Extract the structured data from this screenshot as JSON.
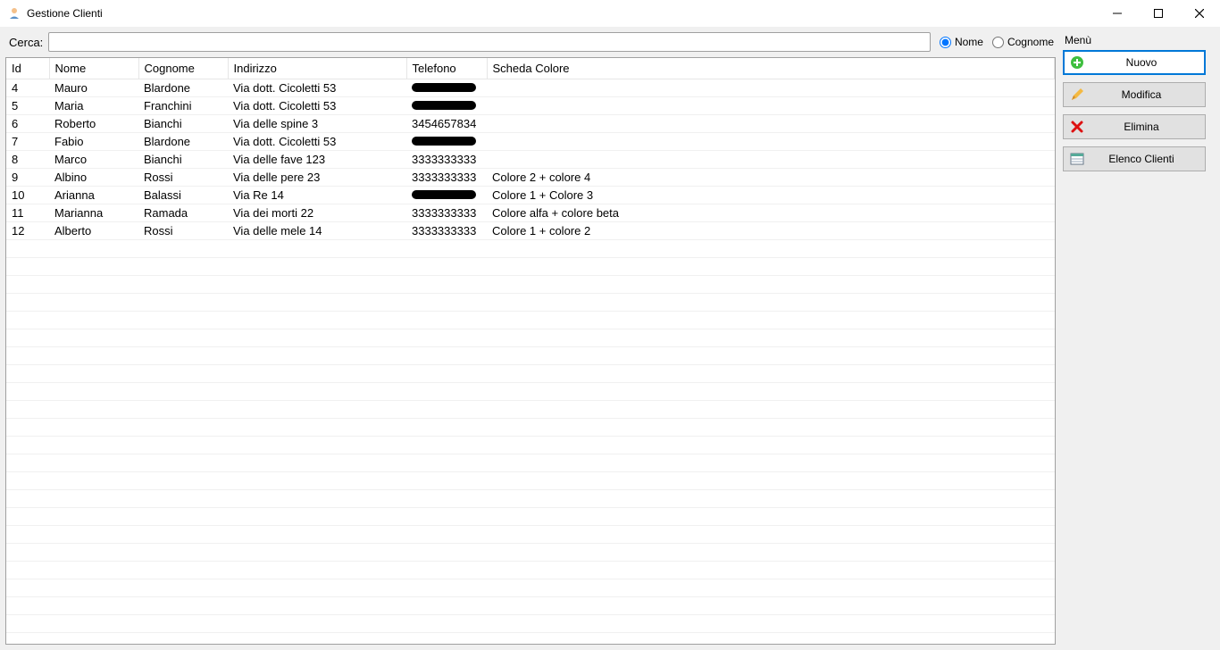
{
  "window": {
    "title": "Gestione Clienti"
  },
  "search": {
    "label": "Cerca:",
    "value": "",
    "radio_nome": "Nome",
    "radio_cognome": "Cognome"
  },
  "columns": {
    "id": "Id",
    "nome": "Nome",
    "cognome": "Cognome",
    "indirizzo": "Indirizzo",
    "telefono": "Telefono",
    "scheda": "Scheda Colore"
  },
  "rows": [
    {
      "id": "4",
      "nome": "Mauro",
      "cognome": "Blardone",
      "indirizzo": "Via dott. Cicoletti 53",
      "telefono_redacted": true,
      "telefono": "",
      "scheda": ""
    },
    {
      "id": "5",
      "nome": "Maria",
      "cognome": "Franchini",
      "indirizzo": "Via dott. Cicoletti 53",
      "telefono_redacted": true,
      "telefono": "",
      "scheda": ""
    },
    {
      "id": "6",
      "nome": "Roberto",
      "cognome": "Bianchi",
      "indirizzo": "Via delle spine 3",
      "telefono_redacted": false,
      "telefono": "3454657834",
      "scheda": ""
    },
    {
      "id": "7",
      "nome": "Fabio",
      "cognome": "Blardone",
      "indirizzo": "Via dott. Cicoletti 53",
      "telefono_redacted": true,
      "telefono": "",
      "scheda": ""
    },
    {
      "id": "8",
      "nome": "Marco",
      "cognome": "Bianchi",
      "indirizzo": "Via delle fave 123",
      "telefono_redacted": false,
      "telefono": "3333333333",
      "scheda": ""
    },
    {
      "id": "9",
      "nome": "Albino",
      "cognome": "Rossi",
      "indirizzo": "Via delle pere 23",
      "telefono_redacted": false,
      "telefono": "3333333333",
      "scheda": "Colore 2 + colore 4"
    },
    {
      "id": "10",
      "nome": "Arianna",
      "cognome": "Balassi",
      "indirizzo": "Via Re 14",
      "telefono_redacted": true,
      "telefono": "",
      "scheda": "Colore 1 + Colore 3"
    },
    {
      "id": "11",
      "nome": "Marianna",
      "cognome": "Ramada",
      "indirizzo": "Via dei morti 22",
      "telefono_redacted": false,
      "telefono": "3333333333",
      "scheda": "Colore alfa + colore beta"
    },
    {
      "id": "12",
      "nome": "Alberto",
      "cognome": "Rossi",
      "indirizzo": "Via delle mele 14",
      "telefono_redacted": false,
      "telefono": "3333333333",
      "scheda": "Colore 1 + colore 2"
    }
  ],
  "menu": {
    "header": "Menù",
    "nuovo": "Nuovo",
    "modifica": "Modifica",
    "elimina": "Elimina",
    "elenco": "Elenco Clienti"
  }
}
